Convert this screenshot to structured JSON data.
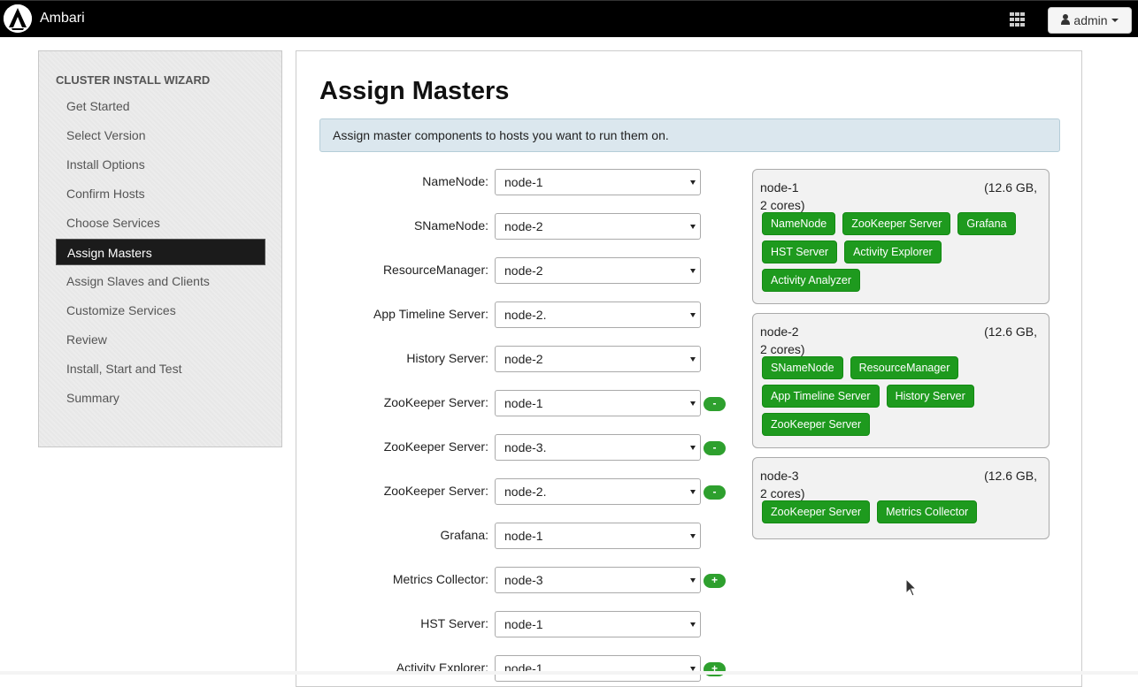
{
  "topbar": {
    "brand": "Ambari",
    "user_label": "admin",
    "apps_icon": "grid-icon",
    "user_icon": "user-icon"
  },
  "sidebar": {
    "title": "CLUSTER INSTALL WIZARD",
    "items": [
      {
        "label": "Get Started",
        "active": false
      },
      {
        "label": "Select Version",
        "active": false
      },
      {
        "label": "Install Options",
        "active": false
      },
      {
        "label": "Confirm Hosts",
        "active": false
      },
      {
        "label": "Choose Services",
        "active": false
      },
      {
        "label": "Assign Masters",
        "active": true
      },
      {
        "label": "Assign Slaves and Clients",
        "active": false
      },
      {
        "label": "Customize Services",
        "active": false
      },
      {
        "label": "Review",
        "active": false
      },
      {
        "label": "Install, Start and Test",
        "active": false
      },
      {
        "label": "Summary",
        "active": false
      }
    ]
  },
  "main": {
    "title": "Assign Masters",
    "info": "Assign master components to hosts you want to run them on.",
    "assignments": [
      {
        "label": "NameNode:",
        "value": "node-1",
        "button": ""
      },
      {
        "label": "SNameNode:",
        "value": "node-2",
        "button": ""
      },
      {
        "label": "ResourceManager:",
        "value": "node-2",
        "button": ""
      },
      {
        "label": "App Timeline Server:",
        "value": "node-2.",
        "button": ""
      },
      {
        "label": "History Server:",
        "value": "node-2",
        "button": ""
      },
      {
        "label": "ZooKeeper Server:",
        "value": "node-1",
        "button": "-"
      },
      {
        "label": "ZooKeeper Server:",
        "value": "node-3.",
        "button": "-"
      },
      {
        "label": "ZooKeeper Server:",
        "value": "node-2.",
        "button": "-"
      },
      {
        "label": "Grafana:",
        "value": "node-1",
        "button": ""
      },
      {
        "label": "Metrics Collector:",
        "value": "node-3",
        "button": "+"
      },
      {
        "label": "HST Server:",
        "value": "node-1",
        "button": ""
      },
      {
        "label": "Activity Explorer:",
        "value": "node-1",
        "button": "+"
      }
    ],
    "hosts": [
      {
        "name": "node-1",
        "spec": "(12.6 GB,",
        "cores": "2 cores)",
        "components": [
          "NameNode",
          "ZooKeeper Server",
          "Grafana",
          "HST Server",
          "Activity Explorer",
          "Activity Analyzer"
        ]
      },
      {
        "name": "node-2",
        "spec": "(12.6 GB,",
        "cores": "2 cores)",
        "components": [
          "SNameNode",
          "ResourceManager",
          "App Timeline Server",
          "History Server",
          "ZooKeeper Server"
        ]
      },
      {
        "name": "node-3",
        "spec": "(12.6 GB,",
        "cores": "2 cores)",
        "components": [
          "ZooKeeper Server",
          "Metrics Collector"
        ]
      }
    ]
  },
  "colors": {
    "topbar": "#000000",
    "chip": "#1e9a1e",
    "info_bg": "#dbe7ee",
    "active_nav": "#1b1b1b"
  }
}
